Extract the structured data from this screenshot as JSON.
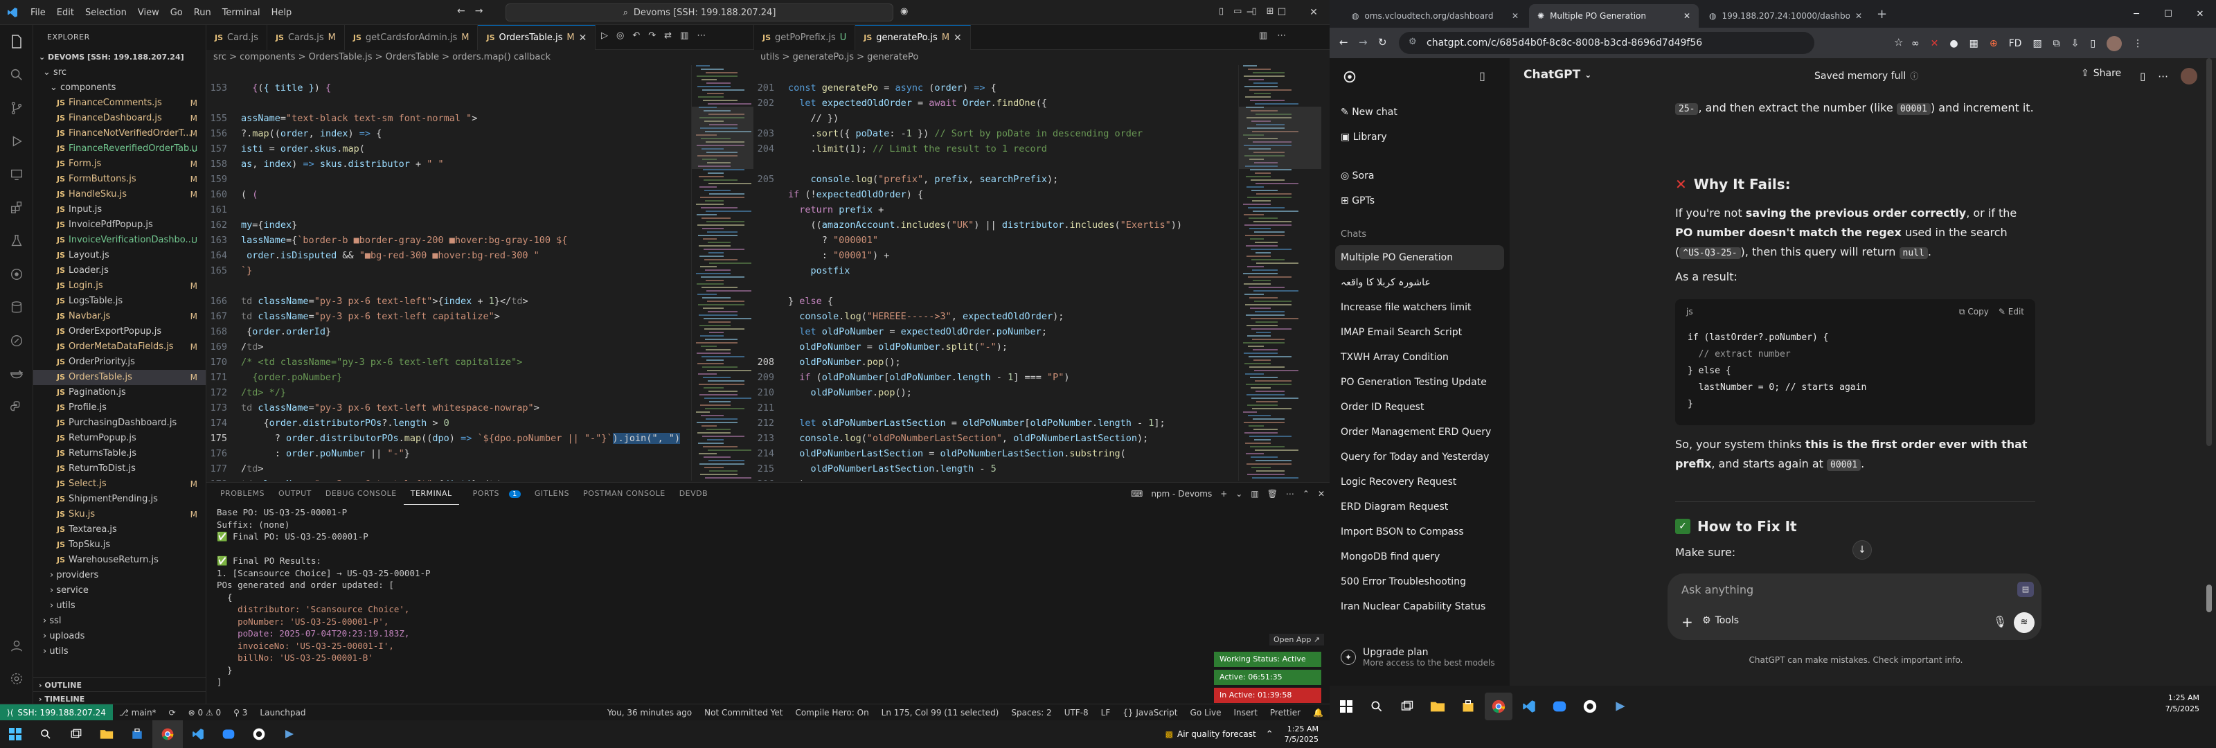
{
  "vscode": {
    "menu": [
      "File",
      "Edit",
      "Selection",
      "View",
      "Go",
      "Run",
      "Terminal",
      "Help"
    ],
    "search": "Devoms [SSH: 199.188.207.24]",
    "explorer": {
      "header": "EXPLORER",
      "root": "DEVOMS [SSH: 199.188.207.24]",
      "items": [
        {
          "indent": 1,
          "name": "src",
          "folder": true,
          "status": ""
        },
        {
          "indent": 2,
          "name": "components",
          "folder": true,
          "status": ""
        },
        {
          "indent": 3,
          "name": "FinanceComments.js",
          "folder": false,
          "status": "M"
        },
        {
          "indent": 3,
          "name": "FinanceDashboard.js",
          "folder": false,
          "status": "M"
        },
        {
          "indent": 3,
          "name": "FinanceNotVerifiedOrderT...",
          "folder": false,
          "status": "M"
        },
        {
          "indent": 3,
          "name": "FinanceReverifiedOrderTab...",
          "folder": false,
          "status": "U"
        },
        {
          "indent": 3,
          "name": "Form.js",
          "folder": false,
          "status": "M"
        },
        {
          "indent": 3,
          "name": "FormButtons.js",
          "folder": false,
          "status": "M"
        },
        {
          "indent": 3,
          "name": "HandleSku.js",
          "folder": false,
          "status": "M"
        },
        {
          "indent": 3,
          "name": "Input.js",
          "folder": false,
          "status": ""
        },
        {
          "indent": 3,
          "name": "InvoicePdfPopup.js",
          "folder": false,
          "status": ""
        },
        {
          "indent": 3,
          "name": "InvoiceVerificationDashbo...",
          "folder": false,
          "status": "U"
        },
        {
          "indent": 3,
          "name": "Layout.js",
          "folder": false,
          "status": ""
        },
        {
          "indent": 3,
          "name": "Loader.js",
          "folder": false,
          "status": ""
        },
        {
          "indent": 3,
          "name": "Login.js",
          "folder": false,
          "status": "M"
        },
        {
          "indent": 3,
          "name": "LogsTable.js",
          "folder": false,
          "status": ""
        },
        {
          "indent": 3,
          "name": "Navbar.js",
          "folder": false,
          "status": "M"
        },
        {
          "indent": 3,
          "name": "OrderExportPopup.js",
          "folder": false,
          "status": ""
        },
        {
          "indent": 3,
          "name": "OrderMetaDataFields.js",
          "folder": false,
          "status": "M"
        },
        {
          "indent": 3,
          "name": "OrderPriority.js",
          "folder": false,
          "status": ""
        },
        {
          "indent": 3,
          "name": "OrdersTable.js",
          "folder": false,
          "status": "M"
        },
        {
          "indent": 3,
          "name": "Pagination.js",
          "folder": false,
          "status": ""
        },
        {
          "indent": 3,
          "name": "Profile.js",
          "folder": false,
          "status": ""
        },
        {
          "indent": 3,
          "name": "PurchasingDashboard.js",
          "folder": false,
          "status": ""
        },
        {
          "indent": 3,
          "name": "ReturnPopup.js",
          "folder": false,
          "status": ""
        },
        {
          "indent": 3,
          "name": "ReturnsTable.js",
          "folder": false,
          "status": ""
        },
        {
          "indent": 3,
          "name": "ReturnToDist.js",
          "folder": false,
          "status": ""
        },
        {
          "indent": 3,
          "name": "Select.js",
          "folder": false,
          "status": "M"
        },
        {
          "indent": 3,
          "name": "ShipmentPending.js",
          "folder": false,
          "status": ""
        },
        {
          "indent": 3,
          "name": "Sku.js",
          "folder": false,
          "status": "M"
        },
        {
          "indent": 3,
          "name": "Textarea.js",
          "folder": false,
          "status": ""
        },
        {
          "indent": 3,
          "name": "TopSku.js",
          "folder": false,
          "status": ""
        },
        {
          "indent": 3,
          "name": "WarehouseReturn.js",
          "folder": false,
          "status": ""
        },
        {
          "indent": 2,
          "name": "providers",
          "folder": true,
          "status": ""
        },
        {
          "indent": 2,
          "name": "service",
          "folder": true,
          "status": ""
        },
        {
          "indent": 2,
          "name": "utils",
          "folder": true,
          "status": ""
        },
        {
          "indent": 1,
          "name": "ssl",
          "folder": true,
          "status": ""
        },
        {
          "indent": 1,
          "name": "uploads",
          "folder": true,
          "status": ""
        },
        {
          "indent": 1,
          "name": "utils",
          "folder": true,
          "status": ""
        }
      ],
      "outline": "OUTLINE",
      "timeline": "TIMELINE"
    },
    "left_tabs": [
      {
        "label": "Card.js",
        "mark": ""
      },
      {
        "label": "Cards.js",
        "mark": "M"
      },
      {
        "label": "getCardsforAdmin.js",
        "mark": "M"
      },
      {
        "label": "OrdersTable.js",
        "mark": "M"
      }
    ],
    "right_tabs": [
      {
        "label": "getPoPrefix.js",
        "mark": "U"
      },
      {
        "label": "generatePo.js",
        "mark": "M"
      }
    ],
    "left_breadcrumb": "src > components > OrdersTable.js > OrdersTable > orders.map() callback",
    "right_breadcrumb": "utils > generatePo.js > generatePo",
    "left_code_start": 153,
    "right_code_start": 201,
    "panel_tabs": [
      "PROBLEMS",
      "OUTPUT",
      "DEBUG CONSOLE",
      "TERMINAL",
      "PORTS",
      "GITLENS",
      "POSTMAN CONSOLE",
      "DEVDB"
    ],
    "ports_badge": "1",
    "terminal_name": "npm - Devoms",
    "terminal_lines": [
      "Base PO: US-Q3-25-00001-P",
      "Suffix: (none)",
      "✅ Final PO: US-Q3-25-00001-P",
      "",
      "✅ Final PO Results:",
      "1. [Scansource Choice] → US-Q3-25-00001-P",
      "POs generated and order updated: [",
      "  {",
      "    distributor: 'Scansource Choice',",
      "    poNumber: 'US-Q3-25-00001-P',",
      "    poDate: 2025-07-04T20:23:19.183Z,",
      "    invoiceNo: 'US-Q3-25-00001-I',",
      "    billNo: 'US-Q3-25-00001-B'",
      "  }",
      "]"
    ],
    "open_app": "Open App ↗",
    "working_status": "Working Status: Active",
    "active_time": "Active: 06:51:35",
    "inactive_time": "In Active: 01:39:58",
    "status": {
      "remote": "SSH: 199.188.207.24",
      "branch": "main*",
      "sync": "⟳",
      "problems": "⊗ 0 ⚠ 0",
      "ports": "⚲ 3",
      "launchpad": "Launchpad",
      "blame": "You, 36 minutes ago",
      "commit": "Not Committed Yet",
      "compile": "Compile Hero: On",
      "cursor": "Ln 175, Col 99 (11 selected)",
      "spaces": "Spaces: 2",
      "encoding": "UTF-8",
      "eol": "LF",
      "lang": "{} JavaScript",
      "golive": "Go Live",
      "insert": "Insert",
      "prettier": "Prettier"
    }
  },
  "taskbar_left": {
    "weather": "Air quality forecast",
    "time": "1:25 AM",
    "date": "7/5/2025"
  },
  "chrome": {
    "tabs": [
      {
        "label": "oms.vcloudtech.org/dashboard",
        "active": false
      },
      {
        "label": "Multiple PO Generation",
        "active": true
      },
      {
        "label": "199.188.207.24:10000/dashbo...",
        "active": false
      }
    ],
    "url": "chatgpt.com/c/685d4b0f-8c8c-8008-b3cd-8696d7d49f56"
  },
  "gpt": {
    "sidebar": {
      "new_chat": "New chat",
      "library": "Library",
      "sora": "Sora",
      "gpts": "GPTs",
      "chats_header": "Chats",
      "chats": [
        "Multiple PO Generation",
        "عاشورہ کربلا کا واقعہ",
        "Increase file watchers limit",
        "IMAP Email Search Script",
        "TXWH Array Condition",
        "PO Generation Testing Update",
        "Order ID Request",
        "Order Management ERD Query",
        "Query for Today and Yesterday",
        "Logic Recovery Request",
        "ERD Diagram Request",
        "Import BSON to Compass",
        "MongoDB find query",
        "500 Error Troubleshooting",
        "Iran Nuclear Capability Status"
      ],
      "upgrade_title": "Upgrade plan",
      "upgrade_sub": "More access to the best models"
    },
    "model": "ChatGPT",
    "saved_memory": "Saved memory full",
    "share": "Share",
    "top_line_code": "25-",
    "top_line_text": ", and then extract the number (like",
    "top_line_code2": "00001",
    "top_line_end": ") and increment it.",
    "why_title": "Why It Fails:",
    "why_p1_a": "If you're not",
    "why_p1_b": "saving the previous order correctly",
    "why_p1_c": ", or if the",
    "why_p1_d": "PO number doesn't match the regex",
    "why_p1_e": "used in the search (",
    "why_p1_code": "^US-Q3-25-",
    "why_p1_f": "), then this query will return",
    "why_p1_null": "null",
    "as_result": "As a result:",
    "code_lang": "js",
    "code_copy": "Copy",
    "code_edit": "Edit",
    "code_lines": [
      "if (lastOrder?.poNumber) {",
      "  // extract number",
      "} else {",
      "  lastNumber = 0; // starts again",
      "}"
    ],
    "so_a": "So, your system thinks",
    "so_b": "this is the first order ever with that prefix",
    "so_c": ", and starts again at",
    "so_code": "00001",
    "fix_title": "How to Fix It",
    "make_sure": "Make sure:",
    "composer_placeholder": "Ask anything",
    "tools": "Tools",
    "disclaimer": "ChatGPT can make mistakes. Check important info."
  },
  "taskbar_right": {
    "time": "1:25 AM",
    "date": "7/5/2025"
  },
  "colors": {
    "vscode_bg": "#1e1e1e",
    "accent": "#0078d4",
    "remote": "#16825d",
    "gpt_bg": "#212121",
    "active_green": "#2e7d32",
    "inactive_red": "#c62828"
  }
}
